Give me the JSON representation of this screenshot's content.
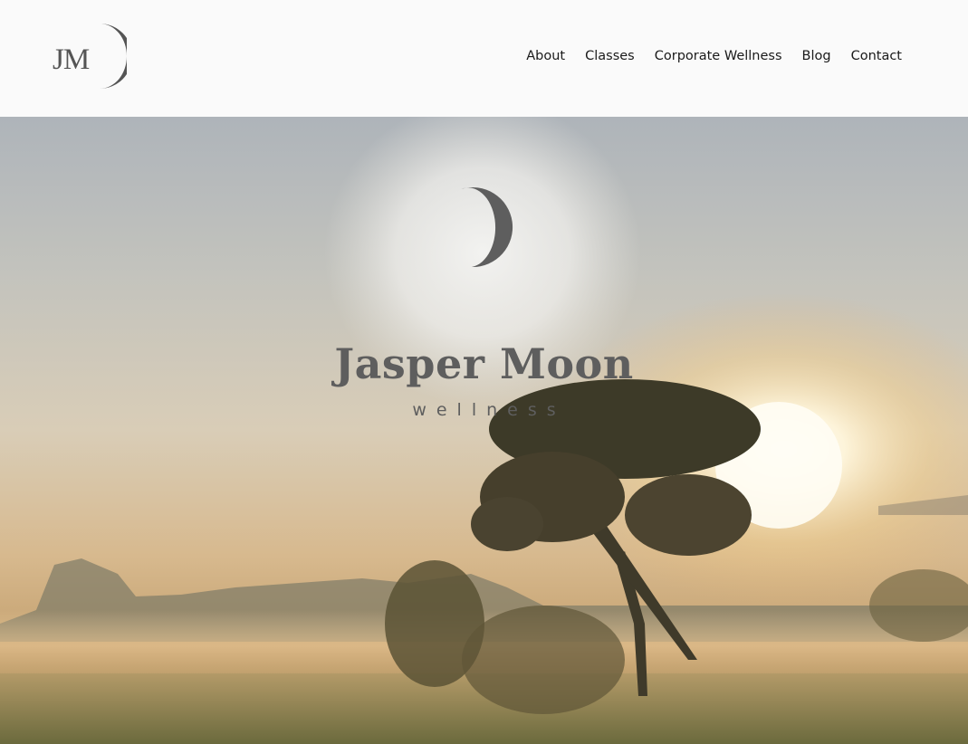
{
  "header": {
    "logo_text": "JM",
    "nav": [
      {
        "label": "About"
      },
      {
        "label": "Classes"
      },
      {
        "label": "Corporate Wellness"
      },
      {
        "label": "Blog"
      },
      {
        "label": "Contact"
      }
    ]
  },
  "hero": {
    "brand_name": "Jasper Moon",
    "brand_subtitle": "wellness"
  },
  "colors": {
    "logo_gray": "#555555",
    "brand_gray": "#5e5e5e",
    "header_bg": "#fafafa"
  }
}
